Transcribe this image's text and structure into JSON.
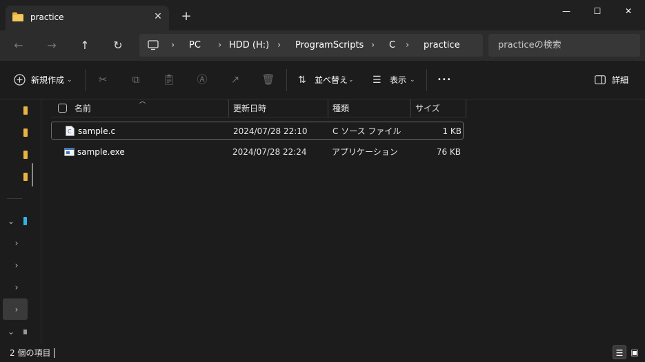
{
  "window": {
    "tab_title": "practice",
    "new_tab_symbol": "+",
    "controls": {
      "minimize": "—",
      "maximize": "☐",
      "close": "✕"
    }
  },
  "nav": {
    "breadcrumbs": [
      "PC",
      "HDD (H:)",
      "ProgramScripts",
      "C",
      "practice"
    ],
    "search_placeholder": "practiceの検索"
  },
  "toolbar": {
    "new_label": "新規作成",
    "sort_label": "並べ替え",
    "view_label": "表示",
    "more_label": "•••",
    "details_label": "詳細"
  },
  "columns": {
    "name": "名前",
    "modified": "更新日時",
    "type": "種類",
    "size": "サイズ"
  },
  "files": [
    {
      "name": "sample.c",
      "modified": "2024/07/28 22:10",
      "type": "C ソース ファイル",
      "size": "1 KB",
      "icon": "c-source-file-icon"
    },
    {
      "name": "sample.exe",
      "modified": "2024/07/28 22:24",
      "type": "アプリケーション",
      "size": "76 KB",
      "icon": "application-file-icon"
    }
  ],
  "status": {
    "item_count": "2 個の項目"
  },
  "colors": {
    "background": "#1c1c1c",
    "folder": "#e8b341",
    "accent": "#4c8ad8"
  }
}
